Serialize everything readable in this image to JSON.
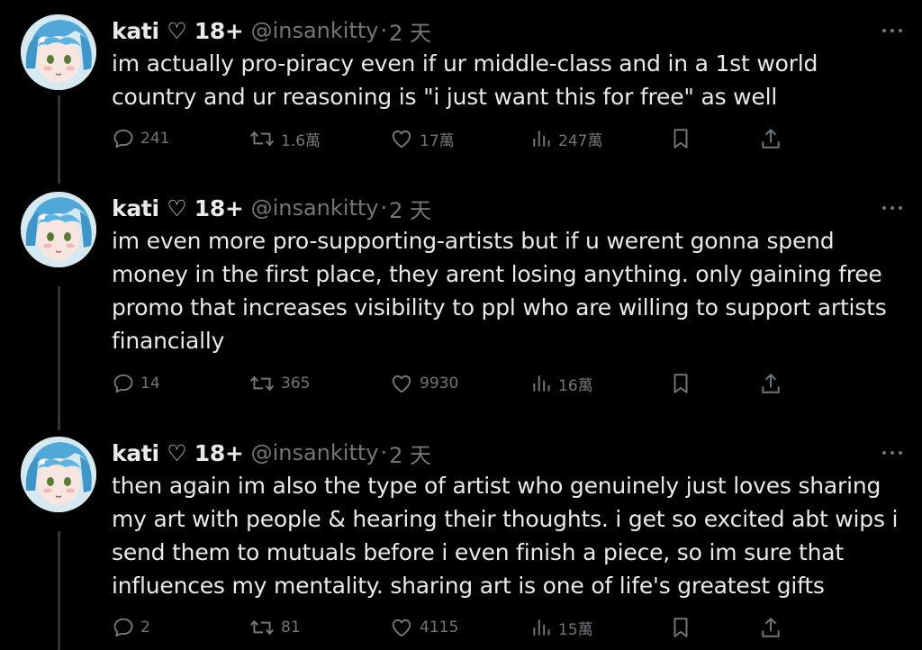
{
  "tweets": [
    {
      "name": "kati ♡ 18+",
      "handle": "@insankitty",
      "separator": "·",
      "time": "2 天",
      "text": "im actually pro-piracy even if ur middle-class and in a 1st world country and ur reasoning is \"i just want this for free\" as well",
      "replies": "241",
      "retweets": "1.6萬",
      "likes": "17萬",
      "views": "247萬"
    },
    {
      "name": "kati ♡ 18+",
      "handle": "@insankitty",
      "separator": "·",
      "time": "2 天",
      "text": "im even more pro-supporting-artists but if u werent gonna spend money in the first place, they arent losing anything. only gaining free promo that increases visibility to ppl who are willing to support artists financially",
      "replies": "14",
      "retweets": "365",
      "likes": "9930",
      "views": "16萬"
    },
    {
      "name": "kati ♡ 18+",
      "handle": "@insankitty",
      "separator": "·",
      "time": "2 天",
      "text": "then again im also the type of artist who genuinely just loves sharing my art with people & hearing their thoughts. i get so excited abt wips i send them to mutuals before i even finish a piece, so im sure that influences my mentality. sharing art is one of life's greatest gifts",
      "replies": "2",
      "retweets": "81",
      "likes": "4115",
      "views": "15萬"
    }
  ],
  "icons": {
    "reply": "reply-icon",
    "retweet": "retweet-icon",
    "like": "heart-icon",
    "views": "views-icon",
    "bookmark": "bookmark-icon",
    "share": "share-icon",
    "more": "more-icon"
  },
  "colors": {
    "background": "#000000",
    "text": "#e7e9ea",
    "secondary": "#71767b",
    "thread_line": "#333639"
  }
}
